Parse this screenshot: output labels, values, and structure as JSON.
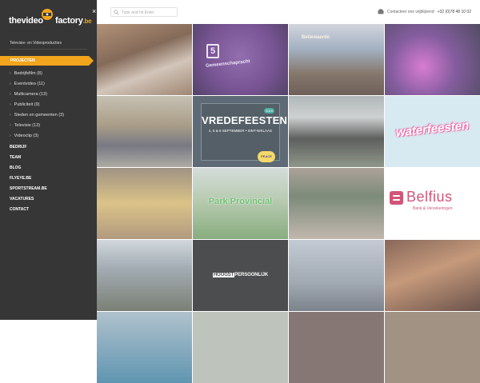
{
  "brand": {
    "the": "thevideo",
    "name": "factory",
    "tld": ".be",
    "tagline": "Televisie- en Videoproducties",
    "accent": "#f1a51d"
  },
  "sidebar": {
    "close_symbol": "×",
    "active_item": "PROJECTEN",
    "sub_items": [
      "Bedrijfsfilm (8)",
      "Eventvideo (11)",
      "Multicamera (13)",
      "Publiciteit (9)",
      "Steden en gemeenten (3)",
      "Televisie (13)",
      "Videoclip (3)"
    ],
    "main_items": [
      "BEDRIJF",
      "TEAM",
      "BLOG",
      "FLYEYE.BE",
      "SPORTSTREAM.BE",
      "VACATURES",
      "CONTACT"
    ]
  },
  "header": {
    "search_placeholder": "Type and hit Enter",
    "contact_label": "Contacteer ons vrijblijvend",
    "phone": "+32 (0)78 48 10 02"
  },
  "tiles": {
    "vredefeesten_title": "VREDEFEESTEN",
    "vredefeesten_dates": "4, 5 & 6 SEPTEMBER • SINT-NIKLAAS",
    "vredefeesten_year": "2015",
    "peace": "PEACE",
    "waterfeesten": "waterfeesten",
    "park": "Park Provincial",
    "belfius_name": "Belfius",
    "belfius_sub": "Bank & Verzekeringen",
    "hoogst_a": "HOOGST",
    "hoogst_b": "PERSOONLIJK",
    "sign_five": "5",
    "sign_text": "Gemeenschapracht",
    "bellewaerde": "Bellewaerde"
  }
}
